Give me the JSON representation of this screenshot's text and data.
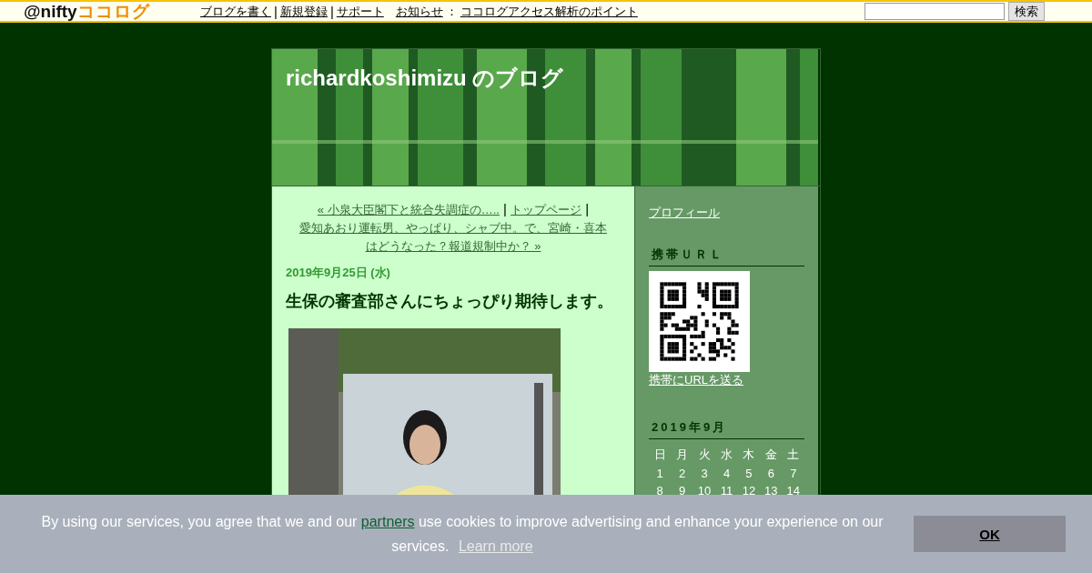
{
  "topbar": {
    "logo": {
      "prefix": "@nifty",
      "name": "ココログ"
    },
    "nav": [
      {
        "kind": "link",
        "text": "ブログを書く"
      },
      {
        "kind": "sep",
        "text": "|"
      },
      {
        "kind": "link",
        "text": "新規登録"
      },
      {
        "kind": "sep",
        "text": "|"
      },
      {
        "kind": "link",
        "text": "サポート"
      }
    ],
    "notice": {
      "label": "お知らせ",
      "colon": "：",
      "link": "ココログアクセス解析のポイント"
    },
    "search": {
      "button": "検索"
    }
  },
  "blog": {
    "title": "richardkoshimizu のブログ",
    "post_nav": [
      {
        "kind": "link",
        "text": "« 小泉大臣閣下と統合失調症の….."
      },
      {
        "kind": "sep",
        "text": "|"
      },
      {
        "kind": "link",
        "text": "トップページ"
      },
      {
        "kind": "sep",
        "text": "|"
      },
      {
        "kind": "link",
        "text": "愛知あおり運転男、やっぱり、シャブ中。で、宮崎・喜本はどうなった？報道規制中か？ »"
      }
    ],
    "date": "2019年9月25日 (水)",
    "post_title": "生保の審査部さんにちょっぴり期待します。"
  },
  "sidebar": {
    "profile_link": "プロフィール",
    "mobile": {
      "heading": "携帯ＵＲＬ",
      "send_link": "携帯にURLを送る"
    },
    "calendar": {
      "heading": "2019年9月",
      "weekdays": [
        "日",
        "月",
        "火",
        "水",
        "木",
        "金",
        "土"
      ],
      "rows": [
        [
          "1",
          "2",
          "3",
          "4",
          "5",
          "6",
          "7"
        ],
        [
          "8",
          "9",
          "10",
          "11",
          "12",
          "13",
          "14"
        ]
      ]
    }
  },
  "cookie_bar": {
    "text_before": "By using our services, you agree that we and our",
    "partners_link": "partners",
    "text_after": "use cookies to improve advertising and enhance your experience on our services.",
    "learn_more": "Learn more",
    "ok_button": "OK"
  }
}
